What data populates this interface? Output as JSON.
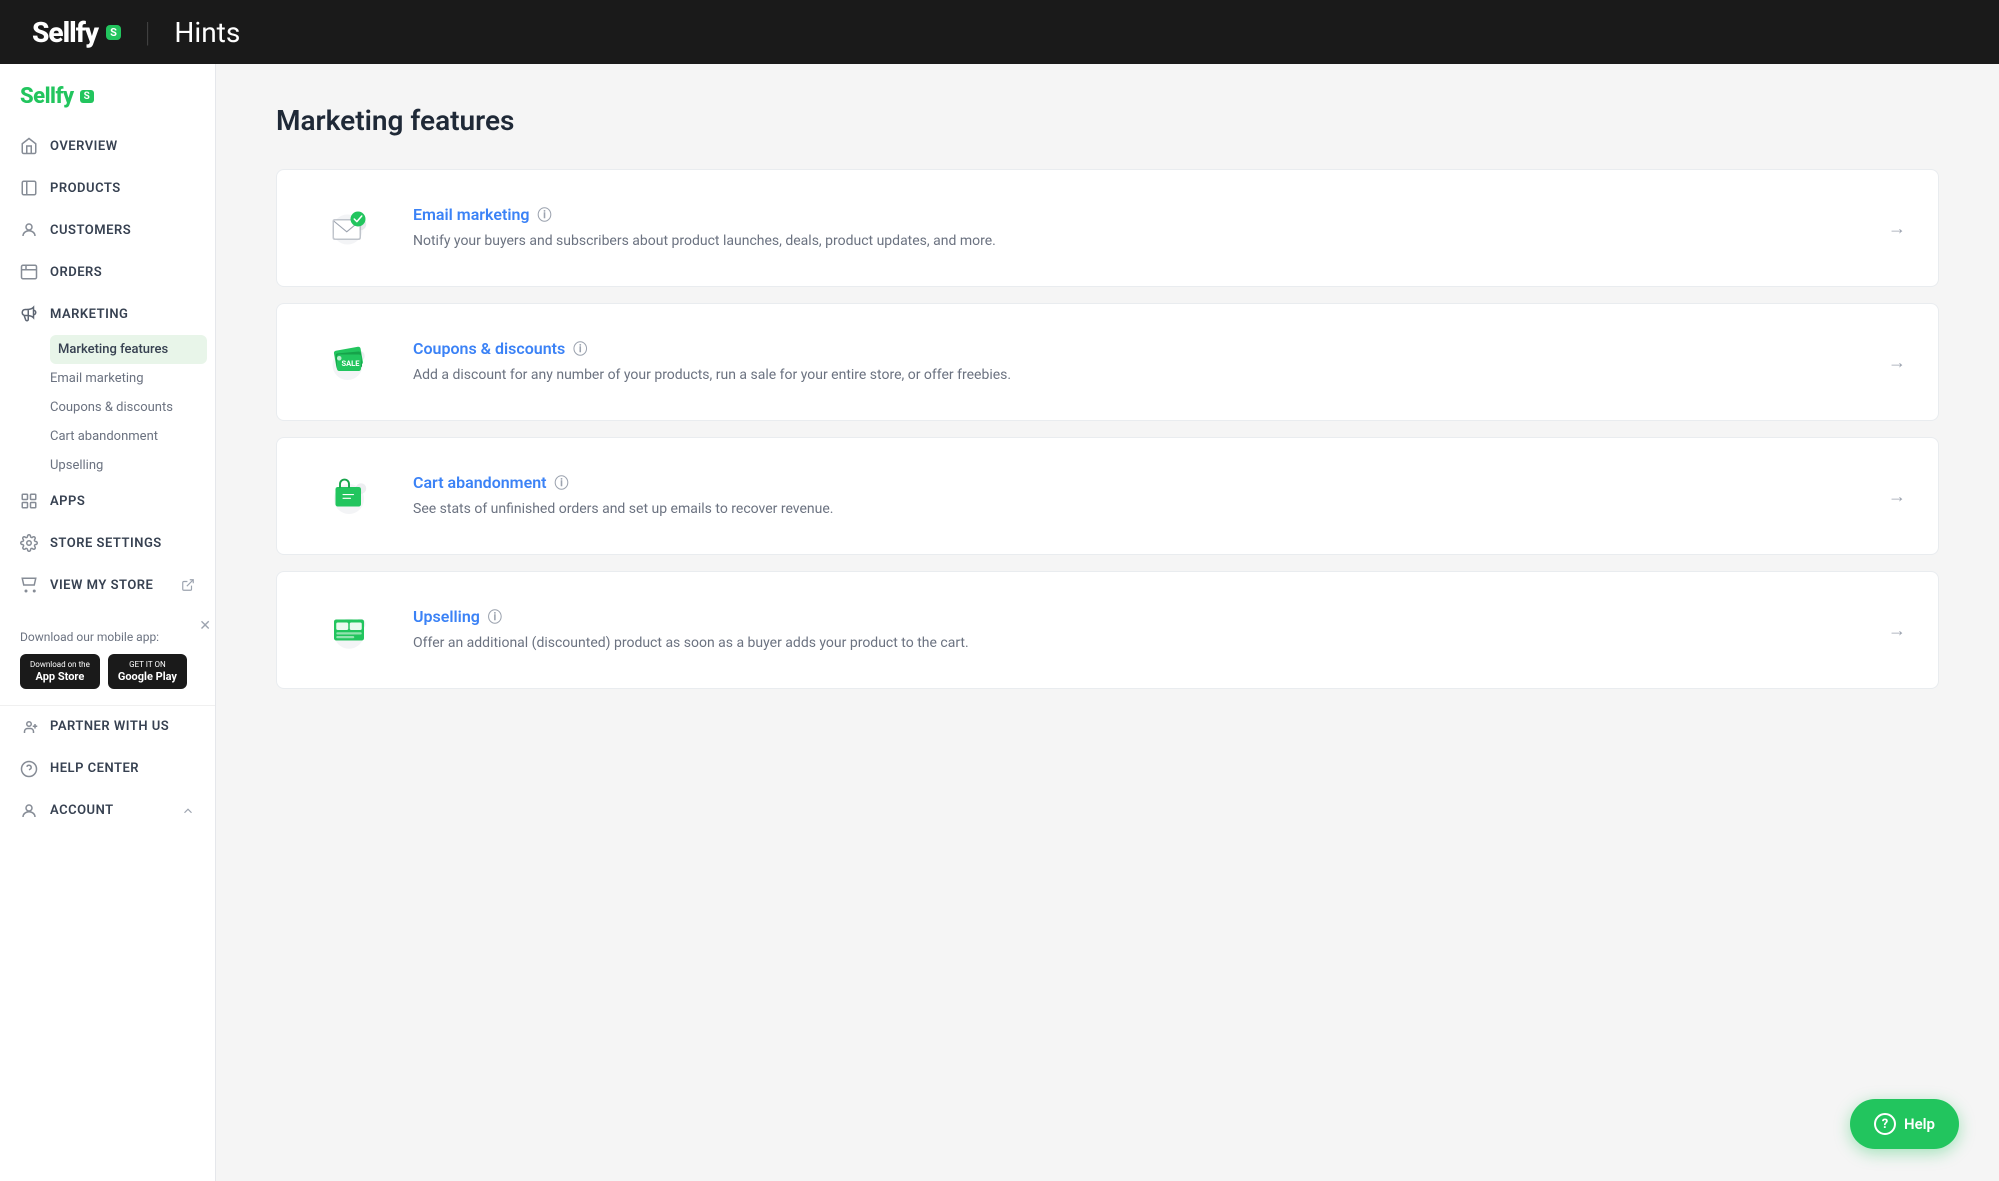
{
  "header": {
    "logo": "Sellfy",
    "logo_badge": "S",
    "divider": "|",
    "title": "Hints"
  },
  "sidebar": {
    "logo": "Sellfy",
    "logo_badge": "S",
    "nav_items": [
      {
        "id": "overview",
        "label": "Overview",
        "icon": "home-icon"
      },
      {
        "id": "products",
        "label": "Products",
        "icon": "products-icon"
      },
      {
        "id": "customers",
        "label": "Customers",
        "icon": "customers-icon"
      },
      {
        "id": "orders",
        "label": "Orders",
        "icon": "orders-icon"
      },
      {
        "id": "marketing",
        "label": "Marketing",
        "icon": "marketing-icon",
        "active": true
      },
      {
        "id": "apps",
        "label": "Apps",
        "icon": "apps-icon"
      },
      {
        "id": "store-settings",
        "label": "Store Settings",
        "icon": "settings-icon"
      },
      {
        "id": "view-my-store",
        "label": "View My Store",
        "icon": "store-icon"
      }
    ],
    "marketing_sub_items": [
      {
        "id": "marketing-features",
        "label": "Marketing features",
        "active": true
      },
      {
        "id": "email-marketing",
        "label": "Email marketing"
      },
      {
        "id": "coupons-discounts",
        "label": "Coupons & discounts"
      },
      {
        "id": "cart-abandonment",
        "label": "Cart abandonment"
      },
      {
        "id": "upselling",
        "label": "Upselling"
      }
    ],
    "mobile_app": {
      "label": "Download our mobile app:",
      "app_store_top": "Download on the",
      "app_store_bottom": "App Store",
      "google_top": "GET IT ON",
      "google_bottom": "Google Play"
    },
    "footer_nav": [
      {
        "id": "partner-with-us",
        "label": "PARTNER WITH US",
        "icon": "partner-icon"
      },
      {
        "id": "help-center",
        "label": "HELP CENTER",
        "icon": "help-center-icon"
      },
      {
        "id": "account",
        "label": "ACCOUNT",
        "icon": "account-icon"
      }
    ]
  },
  "main": {
    "page_title": "Marketing features",
    "features": [
      {
        "id": "email-marketing",
        "title": "Email marketing",
        "description": "Notify your buyers and subscribers about product launches, deals, product updates, and more.",
        "icon": "email-marketing-icon"
      },
      {
        "id": "coupons-discounts",
        "title": "Coupons & discounts",
        "description": "Add a discount for any number of your products, run a sale for your entire store, or offer freebies.",
        "icon": "coupons-icon"
      },
      {
        "id": "cart-abandonment",
        "title": "Cart abandonment",
        "description": "See stats of unfinished orders and set up emails to recover revenue.",
        "icon": "cart-icon"
      },
      {
        "id": "upselling",
        "title": "Upselling",
        "description": "Offer an additional (discounted) product as soon as a buyer adds your product to the cart.",
        "icon": "upselling-icon"
      }
    ]
  },
  "help_button": {
    "label": "Help",
    "icon": "help-question-icon"
  },
  "colors": {
    "green": "#22c55e",
    "blue": "#3b82f6",
    "dark": "#1a1a1a"
  }
}
